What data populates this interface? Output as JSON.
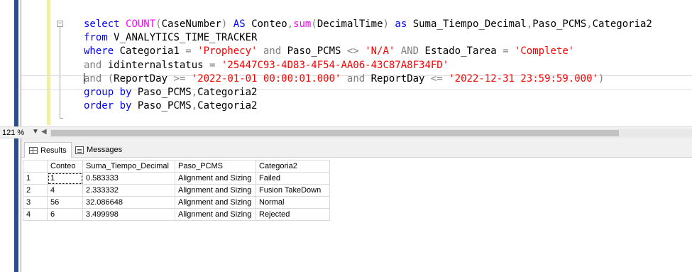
{
  "editor": {
    "lines": [
      [
        [
          "kw",
          "select "
        ],
        [
          "fn",
          "COUNT"
        ],
        [
          "op",
          "("
        ],
        [
          "",
          "CaseNumber"
        ],
        [
          "op",
          ")"
        ],
        [
          "kw",
          " AS "
        ],
        [
          "",
          "Conteo"
        ],
        [
          "op",
          ","
        ],
        [
          "fn",
          "sum"
        ],
        [
          "op",
          "("
        ],
        [
          "",
          "DecimalTime"
        ],
        [
          "op",
          ")"
        ],
        [
          "kw",
          " as "
        ],
        [
          "",
          "Suma_Tiempo_Decimal"
        ],
        [
          "op",
          ","
        ],
        [
          "",
          "Paso_PCMS"
        ],
        [
          "op",
          ","
        ],
        [
          "",
          "Categoria2"
        ]
      ],
      [
        [
          "kw",
          "from "
        ],
        [
          "",
          "V_ANALYTICS_TIME_TRACKER"
        ]
      ],
      [
        [
          "kw",
          "where "
        ],
        [
          "",
          "Categoria1 "
        ],
        [
          "op",
          "= "
        ],
        [
          "str",
          "'Prophecy'"
        ],
        [
          "op",
          " and "
        ],
        [
          "",
          "Paso_PCMS "
        ],
        [
          "op",
          "<> "
        ],
        [
          "str",
          "'N/A'"
        ],
        [
          "op",
          " AND "
        ],
        [
          "",
          "Estado_Tarea "
        ],
        [
          "op",
          "= "
        ],
        [
          "str",
          "'Complete'"
        ]
      ],
      [
        [
          "op",
          "and "
        ],
        [
          "",
          "idinternalstatus "
        ],
        [
          "op",
          "= "
        ],
        [
          "str",
          "'25447C93-4D83-4F54-AA06-43C87A8F34FD'"
        ]
      ],
      [
        [
          "op",
          "and "
        ],
        [
          "op",
          "("
        ],
        [
          "",
          "ReportDay "
        ],
        [
          "op",
          ">= "
        ],
        [
          "str",
          "'2022-01-01 00:00:01.000'"
        ],
        [
          "op",
          " and "
        ],
        [
          "",
          "ReportDay "
        ],
        [
          "op",
          "<= "
        ],
        [
          "str",
          "'2022-12-31 23:59:59.000'"
        ],
        [
          "op",
          ")"
        ]
      ],
      [
        [
          "kw",
          "group by "
        ],
        [
          "",
          "Paso_PCMS"
        ],
        [
          "op",
          ","
        ],
        [
          "",
          "Categoria2"
        ]
      ],
      [
        [
          "kw",
          "order by "
        ],
        [
          "",
          "Paso_PCMS"
        ],
        [
          "op",
          ","
        ],
        [
          "",
          "Categoria2"
        ]
      ]
    ]
  },
  "zoom": {
    "value": "121 %"
  },
  "tabs": {
    "results": "Results",
    "messages": "Messages"
  },
  "grid": {
    "headers": [
      "Conteo",
      "Suma_Tiempo_Decimal",
      "Paso_PCMS",
      "Categoria2"
    ],
    "rows": [
      [
        "1",
        "1",
        "0.583333",
        "Alignment and Sizing",
        "Failed"
      ],
      [
        "2",
        "4",
        "2.333332",
        "Alignment and Sizing",
        "Fusion TakeDown"
      ],
      [
        "3",
        "56",
        "32.086648",
        "Alignment and Sizing",
        "Normal"
      ],
      [
        "4",
        "6",
        "3.499998",
        "Alignment and Sizing",
        "Rejected"
      ]
    ]
  },
  "colors": {
    "keyword": "#0000ff",
    "function": "#ff00ff",
    "string": "#ff0000",
    "operator": "#808080",
    "gutter": "#2a4b8d"
  }
}
